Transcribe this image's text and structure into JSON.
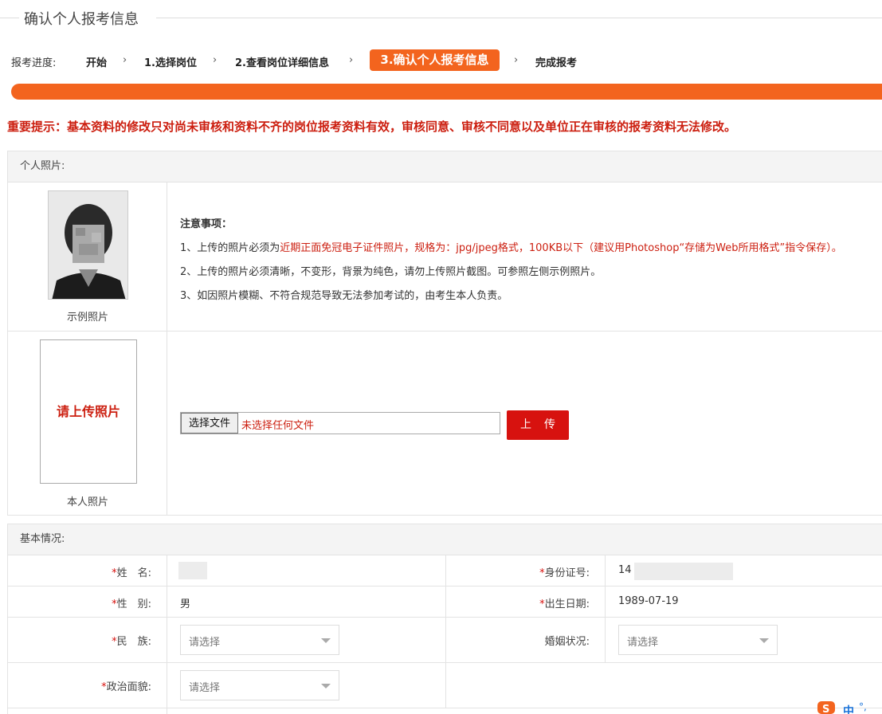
{
  "page_title": "确认个人报考信息",
  "progress": {
    "label": "报考进度:",
    "steps": [
      "开始",
      "1.选择岗位",
      "2.查看岗位详细信息",
      "3.确认个人报考信息",
      "完成报考"
    ],
    "separator": "›"
  },
  "notice": "重要提示：基本资料的修改只对尚未审核和资料不齐的岗位报考资料有效，审核同意、审核不同意以及单位正在审核的报考资料无法修改。",
  "photo_section": {
    "header": "个人照片:",
    "sample_caption": "示例照片",
    "notes_title": "注意事项：",
    "note1_prefix": "1、上传的照片必须为",
    "note1_highlight": "近期正面免冠电子证件照片，规格为：jpg/jpeg格式，100KB以下（建议用Photoshop“存储为Web所用格式”指令保存）。",
    "note2": "2、上传的照片必须清晰，不变形，背景为纯色，请勿上传照片截图。可参照左侧示例照片。",
    "note3": "3、如因照片模糊、不符合规范导致无法参加考试的，由考生本人负责。",
    "upload_placeholder": "请上传照片",
    "own_caption": "本人照片",
    "file_button": "选择文件",
    "file_status": "未选择任何文件",
    "upload_button": "上传"
  },
  "basic_section": {
    "header": "基本情况:",
    "fields": {
      "name_label": "姓　名:",
      "id_label": "身份证号:",
      "id_value_visible": "14",
      "gender_label": "性　别:",
      "gender_value": "男",
      "birth_label": "出生日期:",
      "birth_value": "1989-07-19",
      "ethnic_label": "民　族:",
      "ethnic_placeholder": "请选择",
      "marital_label": "婚姻状况:",
      "marital_placeholder": "请选择",
      "political_label": "政治面貌:",
      "political_placeholder": "请选择"
    },
    "required_mark": "*"
  },
  "ime": {
    "text": "中",
    "extra": "°,"
  },
  "colors": {
    "accent": "#f3641e",
    "danger": "#d7120f",
    "notice": "#cc1f10"
  }
}
